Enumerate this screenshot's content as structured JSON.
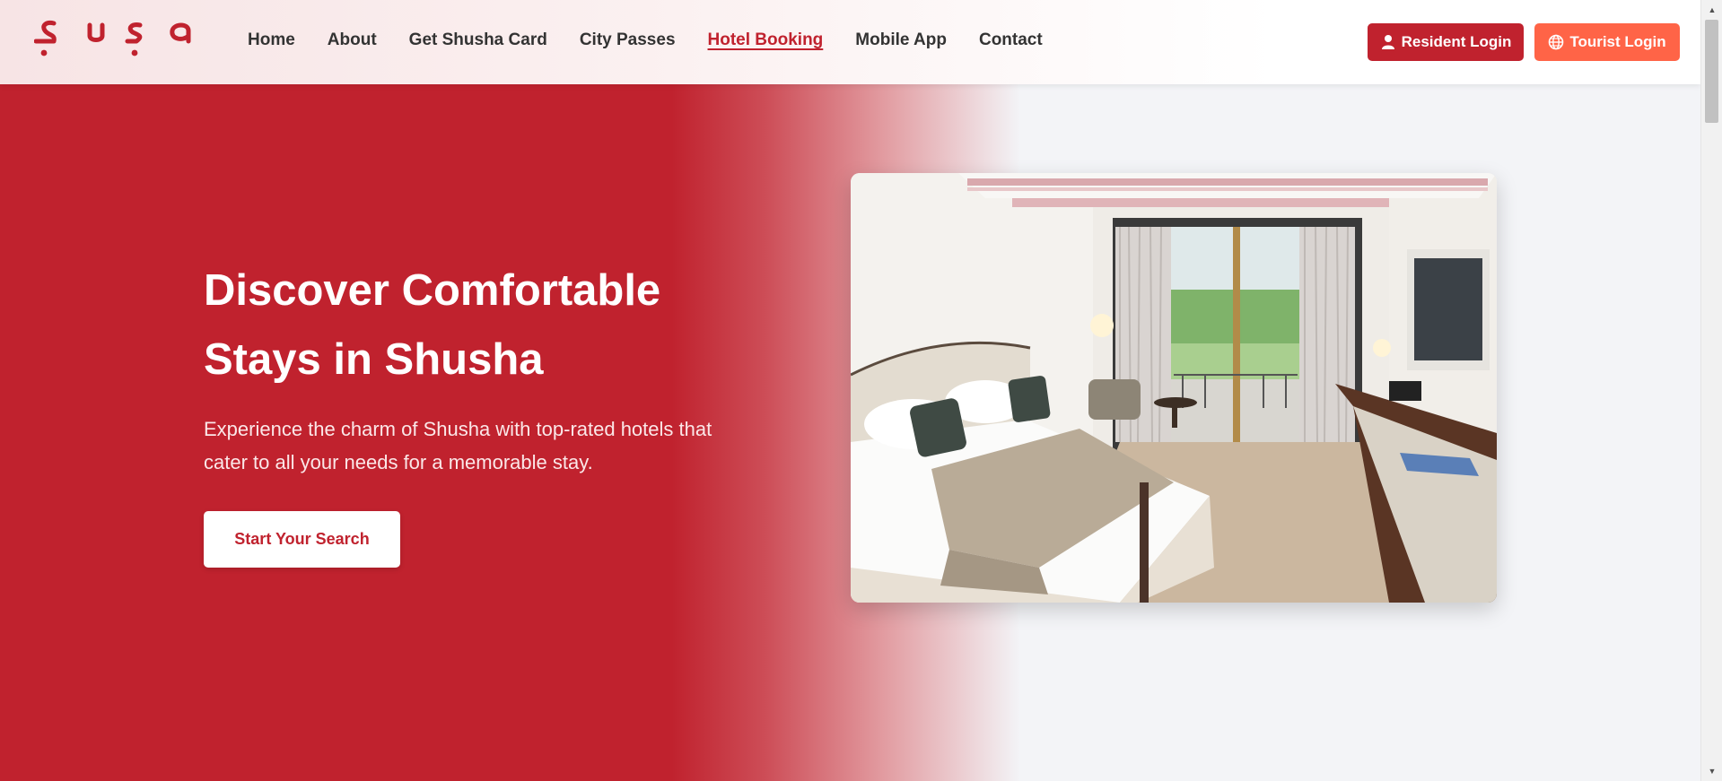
{
  "header": {
    "logo_text": "Şuşa",
    "nav": [
      {
        "label": "Home",
        "active": false
      },
      {
        "label": "About",
        "active": false
      },
      {
        "label": "Get Shusha Card",
        "active": false
      },
      {
        "label": "City Passes",
        "active": false
      },
      {
        "label": "Hotel Booking",
        "active": true
      },
      {
        "label": "Mobile App",
        "active": false
      },
      {
        "label": "Contact",
        "active": false
      }
    ],
    "resident_login": "Resident Login",
    "tourist_login": "Tourist Login"
  },
  "hero": {
    "title_line1": "Discover Comfortable",
    "title_line2": "Stays in Shusha",
    "subtitle_line1": "Experience the charm of Shusha with top-rated hotels that",
    "subtitle_line2": "cater to all your needs for a memorable stay.",
    "cta_label": "Start Your Search",
    "image_alt": "hotel-room-photo"
  },
  "colors": {
    "brand_red": "#c0222e",
    "tourist_orange": "#ff6447",
    "page_bg": "#f3f4f7"
  },
  "icons": {
    "resident": "user-icon",
    "tourist": "globe-icon",
    "scroll_up": "chevron-up-icon",
    "scroll_down": "chevron-down-icon"
  }
}
